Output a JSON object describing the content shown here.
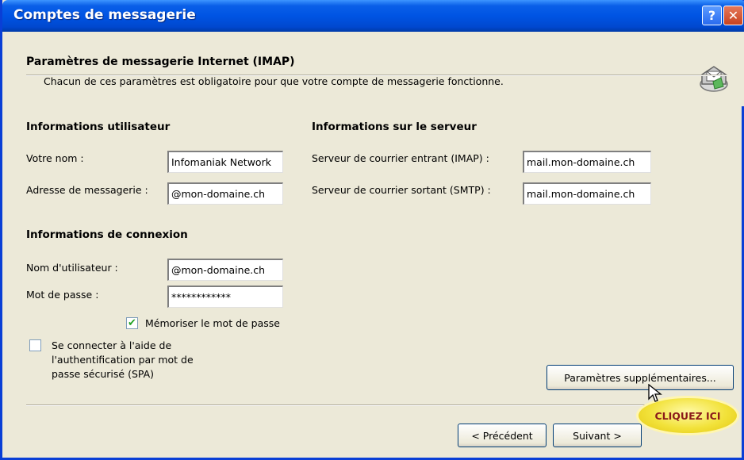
{
  "window": {
    "title": "Comptes de messagerie",
    "help_label": "?",
    "close_label": "✕"
  },
  "header": {
    "title": "Paramètres de messagerie Internet (IMAP)",
    "subtitle": "Chacun de ces paramètres est obligatoire pour que votre compte de messagerie fonctionne.",
    "icon": "mail-account-icon"
  },
  "user_info": {
    "title": "Informations utilisateur",
    "name_label": "Votre nom :",
    "name_value": "Infomaniak Network",
    "email_label": "Adresse de messagerie :",
    "email_value": "@mon-domaine.ch"
  },
  "server_info": {
    "title": "Informations sur le serveur",
    "incoming_label": "Serveur de courrier entrant (IMAP) :",
    "incoming_value": "mail.mon-domaine.ch",
    "outgoing_label": "Serveur de courrier sortant (SMTP) :",
    "outgoing_value": "mail.mon-domaine.ch"
  },
  "logon_info": {
    "title": "Informations de connexion",
    "username_label": "Nom d'utilisateur :",
    "username_value": "@mon-domaine.ch",
    "password_label": "Mot de passe :",
    "password_value": "************",
    "remember_label": "Mémoriser le mot de passe",
    "remember_checked": true,
    "spa_label_line1": "Se connecter à l'aide de",
    "spa_label_line2": "l'authentification par mot de",
    "spa_label_line3": "passe sécurisé (SPA)",
    "spa_checked": false
  },
  "buttons": {
    "more_settings": "Paramètres supplémentaires...",
    "previous": "< Précédent",
    "next": "Suivant >"
  },
  "callout": {
    "text": "CLIQUEZ ICI"
  },
  "colors": {
    "titlebar": "#0054e3",
    "dialog_bg": "#ece9d8",
    "callout": "#f2e23a",
    "check": "#21a121"
  }
}
